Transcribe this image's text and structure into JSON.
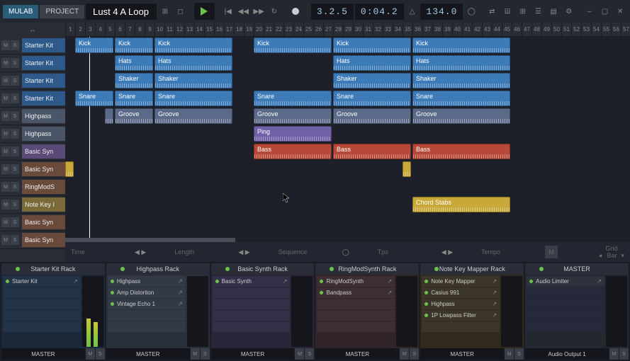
{
  "app": {
    "mulab": "MULAB",
    "project": "PROJECT",
    "name": "Lust 4 A Loop"
  },
  "transport": {
    "position": "3.2.5",
    "time": "0:04.2",
    "tempo": "134.0"
  },
  "ruler_start": 1,
  "ruler_end": 57,
  "tracks": [
    {
      "name": "Starter Kit",
      "color": "tk-blue"
    },
    {
      "name": "Starter Kit",
      "color": "tk-blue"
    },
    {
      "name": "Starter Kit",
      "color": "tk-blue"
    },
    {
      "name": "Starter Kit",
      "color": "tk-blue"
    },
    {
      "name": "Highpass",
      "color": "tk-slate"
    },
    {
      "name": "Highpass",
      "color": "tk-slate"
    },
    {
      "name": "Basic Syn",
      "color": "tk-purple"
    },
    {
      "name": "Basic Syn",
      "color": "tk-brown"
    },
    {
      "name": "RingModS",
      "color": "tk-brown"
    },
    {
      "name": "Note Key I",
      "color": "tk-gold"
    },
    {
      "name": "Basic Syn",
      "color": "tk-brown"
    },
    {
      "name": "Basic Syn",
      "color": "tk-brown"
    }
  ],
  "clips": [
    {
      "track": 0,
      "start": 1,
      "len": 4,
      "label": "Kick",
      "cls": "clip-blue"
    },
    {
      "track": 0,
      "start": 5,
      "len": 4,
      "label": "Kick",
      "cls": "clip-blue"
    },
    {
      "track": 0,
      "start": 9,
      "len": 8,
      "label": "Kick",
      "cls": "clip-blue"
    },
    {
      "track": 0,
      "start": 19,
      "len": 8,
      "label": "Kick",
      "cls": "clip-blue"
    },
    {
      "track": 0,
      "start": 27,
      "len": 8,
      "label": "Kick",
      "cls": "clip-blue"
    },
    {
      "track": 0,
      "start": 35,
      "len": 10,
      "label": "Kick",
      "cls": "clip-blue"
    },
    {
      "track": 1,
      "start": 5,
      "len": 4,
      "label": "Hats",
      "cls": "clip-blue"
    },
    {
      "track": 1,
      "start": 9,
      "len": 8,
      "label": "Hats",
      "cls": "clip-blue"
    },
    {
      "track": 1,
      "start": 27,
      "len": 8,
      "label": "Hats",
      "cls": "clip-blue"
    },
    {
      "track": 1,
      "start": 35,
      "len": 10,
      "label": "Hats",
      "cls": "clip-blue"
    },
    {
      "track": 2,
      "start": 5,
      "len": 4,
      "label": "Shaker",
      "cls": "clip-blue"
    },
    {
      "track": 2,
      "start": 9,
      "len": 8,
      "label": "Shaker",
      "cls": "clip-blue"
    },
    {
      "track": 2,
      "start": 27,
      "len": 8,
      "label": "Shaker",
      "cls": "clip-blue"
    },
    {
      "track": 2,
      "start": 35,
      "len": 10,
      "label": "Shaker",
      "cls": "clip-blue"
    },
    {
      "track": 3,
      "start": 1,
      "len": 4,
      "label": "Snare",
      "cls": "clip-blue"
    },
    {
      "track": 3,
      "start": 5,
      "len": 4,
      "label": "Snare",
      "cls": "clip-blue"
    },
    {
      "track": 3,
      "start": 9,
      "len": 8,
      "label": "Snare",
      "cls": "clip-blue"
    },
    {
      "track": 3,
      "start": 19,
      "len": 8,
      "label": "Snare",
      "cls": "clip-blue"
    },
    {
      "track": 3,
      "start": 27,
      "len": 8,
      "label": "Snare",
      "cls": "clip-blue"
    },
    {
      "track": 3,
      "start": 35,
      "len": 10,
      "label": "Snare",
      "cls": "clip-blue"
    },
    {
      "track": 4,
      "start": 4,
      "len": 1,
      "label": "",
      "cls": "clip-slate"
    },
    {
      "track": 4,
      "start": 5,
      "len": 4,
      "label": "Groove",
      "cls": "clip-slate"
    },
    {
      "track": 4,
      "start": 9,
      "len": 8,
      "label": "Groove",
      "cls": "clip-slate"
    },
    {
      "track": 4,
      "start": 19,
      "len": 8,
      "label": "Groove",
      "cls": "clip-slate"
    },
    {
      "track": 4,
      "start": 27,
      "len": 8,
      "label": "Groove",
      "cls": "clip-slate"
    },
    {
      "track": 4,
      "start": 35,
      "len": 10,
      "label": "Groove",
      "cls": "clip-slate"
    },
    {
      "track": 5,
      "start": 19,
      "len": 8,
      "label": "Ping",
      "cls": "clip-purple"
    },
    {
      "track": 6,
      "start": 19,
      "len": 8,
      "label": "Bass",
      "cls": "clip-red"
    },
    {
      "track": 6,
      "start": 27,
      "len": 8,
      "label": "Bass",
      "cls": "clip-red"
    },
    {
      "track": 6,
      "start": 35,
      "len": 10,
      "label": "Bass",
      "cls": "clip-red"
    },
    {
      "track": 7,
      "start": 0,
      "len": 1,
      "label": "",
      "cls": "clip-gold"
    },
    {
      "track": 7,
      "start": 34,
      "len": 1,
      "label": "",
      "cls": "clip-gold"
    },
    {
      "track": 9,
      "start": 35,
      "len": 10,
      "label": "Chord Stabs",
      "cls": "clip-gold"
    }
  ],
  "info": {
    "time": "Time",
    "length": "Length",
    "sequence": "Sequence",
    "tps": "Tps",
    "tempo": "Tempo",
    "m": "M",
    "grid": "Grid",
    "bar": "Bar"
  },
  "racks": [
    {
      "title": "Starter Kit Rack",
      "cls": "r1",
      "slots": [
        "Starter Kit"
      ],
      "out": "MASTER",
      "meter": 40
    },
    {
      "title": "Highpass Rack",
      "cls": "r2",
      "slots": [
        "Highpass",
        "Amp Distortion",
        "Vintage Echo 1"
      ],
      "out": "MASTER",
      "meter": 0
    },
    {
      "title": "Basic Synth Rack",
      "cls": "r3",
      "slots": [
        "Basic Synth"
      ],
      "out": "MASTER",
      "meter": 0
    },
    {
      "title": "RingModSynth Rack",
      "cls": "r4",
      "slots": [
        "RingModSynth",
        "Bandpass"
      ],
      "out": "MASTER",
      "meter": 0
    },
    {
      "title": "Note Key Mapper Rack",
      "cls": "r5",
      "slots": [
        "Note Key Mapper",
        "Casius 991",
        "Highpass",
        "1P Lowpass Filter"
      ],
      "out": "MASTER",
      "meter": 0
    },
    {
      "title": "MASTER",
      "cls": "",
      "slots": [
        "Audio Limiter"
      ],
      "out": "Audio Output 1",
      "meter": 0
    }
  ]
}
